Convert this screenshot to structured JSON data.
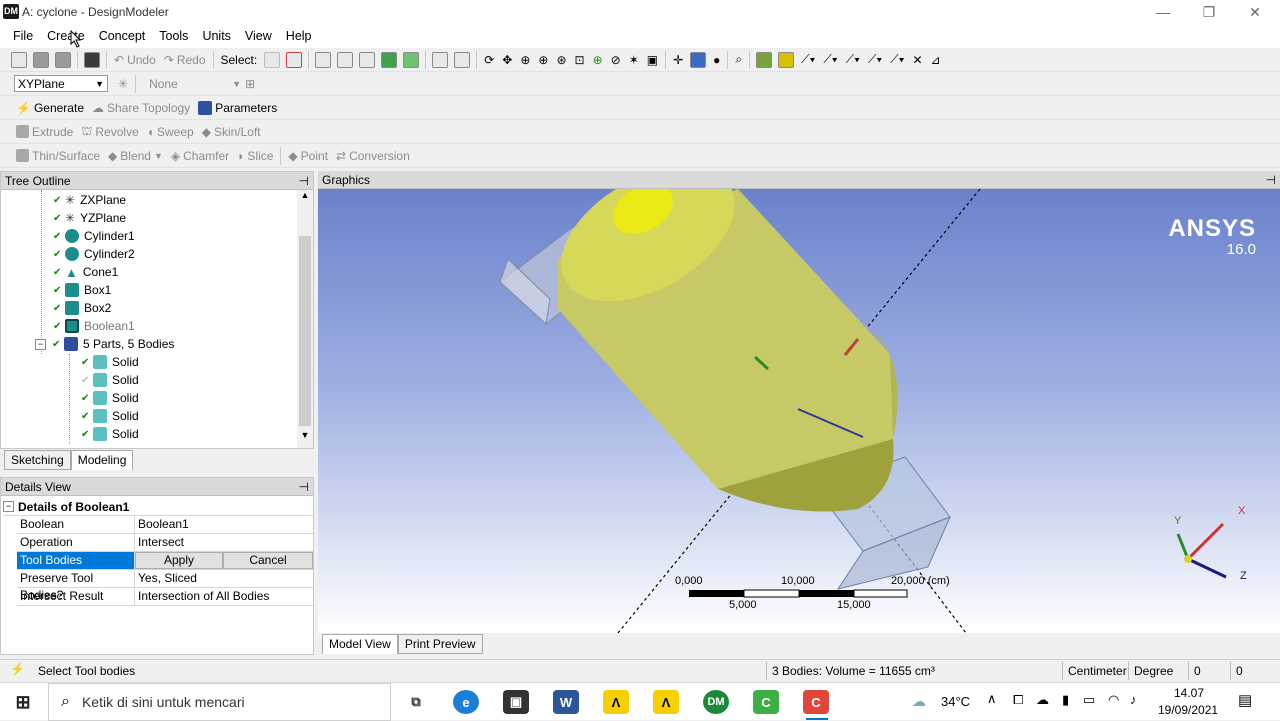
{
  "window": {
    "title": "A: cyclone - DesignModeler",
    "app_icon": "DM",
    "minimize": "—",
    "restore": "❐",
    "close": "✕"
  },
  "menu": [
    "File",
    "Create",
    "Concept",
    "Tools",
    "Units",
    "View",
    "Help"
  ],
  "toolbar1": {
    "undo": "Undo",
    "redo": "Redo",
    "select_label": "Select:"
  },
  "toolbar2": {
    "plane": "XYPlane",
    "sketch": "None"
  },
  "toolbar3": {
    "generate": "Generate",
    "share_topology": "Share Topology",
    "parameters": "Parameters"
  },
  "toolbar4": {
    "extrude": "Extrude",
    "revolve": "Revolve",
    "sweep": "Sweep",
    "skin_loft": "Skin/Loft"
  },
  "toolbar5": {
    "thin_surface": "Thin/Surface",
    "blend": "Blend",
    "chamfer": "Chamfer",
    "slice": "Slice",
    "point": "Point",
    "conversion": "Conversion"
  },
  "tree": {
    "title": "Tree Outline",
    "pin": "⊣",
    "items": [
      {
        "label": "ZXPlane",
        "icon": "plane-icon"
      },
      {
        "label": "YZPlane",
        "icon": "plane-icon"
      },
      {
        "label": "Cylinder1",
        "icon": "cylinder-icon"
      },
      {
        "label": "Cylinder2",
        "icon": "cylinder-icon"
      },
      {
        "label": "Cone1",
        "icon": "cone-icon"
      },
      {
        "label": "Box1",
        "icon": "box-icon"
      },
      {
        "label": "Box2",
        "icon": "box-icon"
      },
      {
        "label": "Boolean1",
        "icon": "boolean-icon"
      },
      {
        "label": "5 Parts, 5 Bodies",
        "icon": "parts-icon"
      },
      {
        "label": "Solid",
        "icon": "solid-icon"
      },
      {
        "label": "Solid",
        "icon": "solid-icon"
      },
      {
        "label": "Solid",
        "icon": "solid-icon"
      },
      {
        "label": "Solid",
        "icon": "solid-icon"
      },
      {
        "label": "Solid",
        "icon": "solid-icon"
      }
    ]
  },
  "tabs": {
    "sketching": "Sketching",
    "modeling": "Modeling"
  },
  "details": {
    "title": "Details View",
    "group": "Details of Boolean1",
    "rows": [
      {
        "key": "Boolean",
        "value": "Boolean1"
      },
      {
        "key": "Operation",
        "value": "Intersect"
      },
      {
        "key": "Tool Bodies",
        "value": ""
      },
      {
        "key": "Preserve Tool Bodies?",
        "value": "Yes, Sliced"
      },
      {
        "key": "Intersect Result",
        "value": "Intersection of All Bodies"
      }
    ],
    "apply": "Apply",
    "cancel": "Cancel"
  },
  "graphics": {
    "title": "Graphics",
    "brand": "ANSYS",
    "version": "16.0",
    "scale": {
      "t0": "0,000",
      "t1": "10,000",
      "t2": "20,000 (cm)",
      "b1": "5,000",
      "b2": "15,000"
    },
    "triad": {
      "x": "X",
      "y": "Y",
      "z": "Z"
    }
  },
  "view_tabs": {
    "model_view": "Model View",
    "print_preview": "Print Preview"
  },
  "status": {
    "message": "Select Tool bodies",
    "volume": "3 Bodies: Volume = 11655 cm³",
    "unit_length": "Centimeter",
    "unit_angle": "Degree",
    "v1": "0",
    "v2": "0"
  },
  "taskbar": {
    "search": "Ketik di sini untuk mencari",
    "temp": "34°C",
    "time": "14.07",
    "date": "19/09/2021"
  }
}
